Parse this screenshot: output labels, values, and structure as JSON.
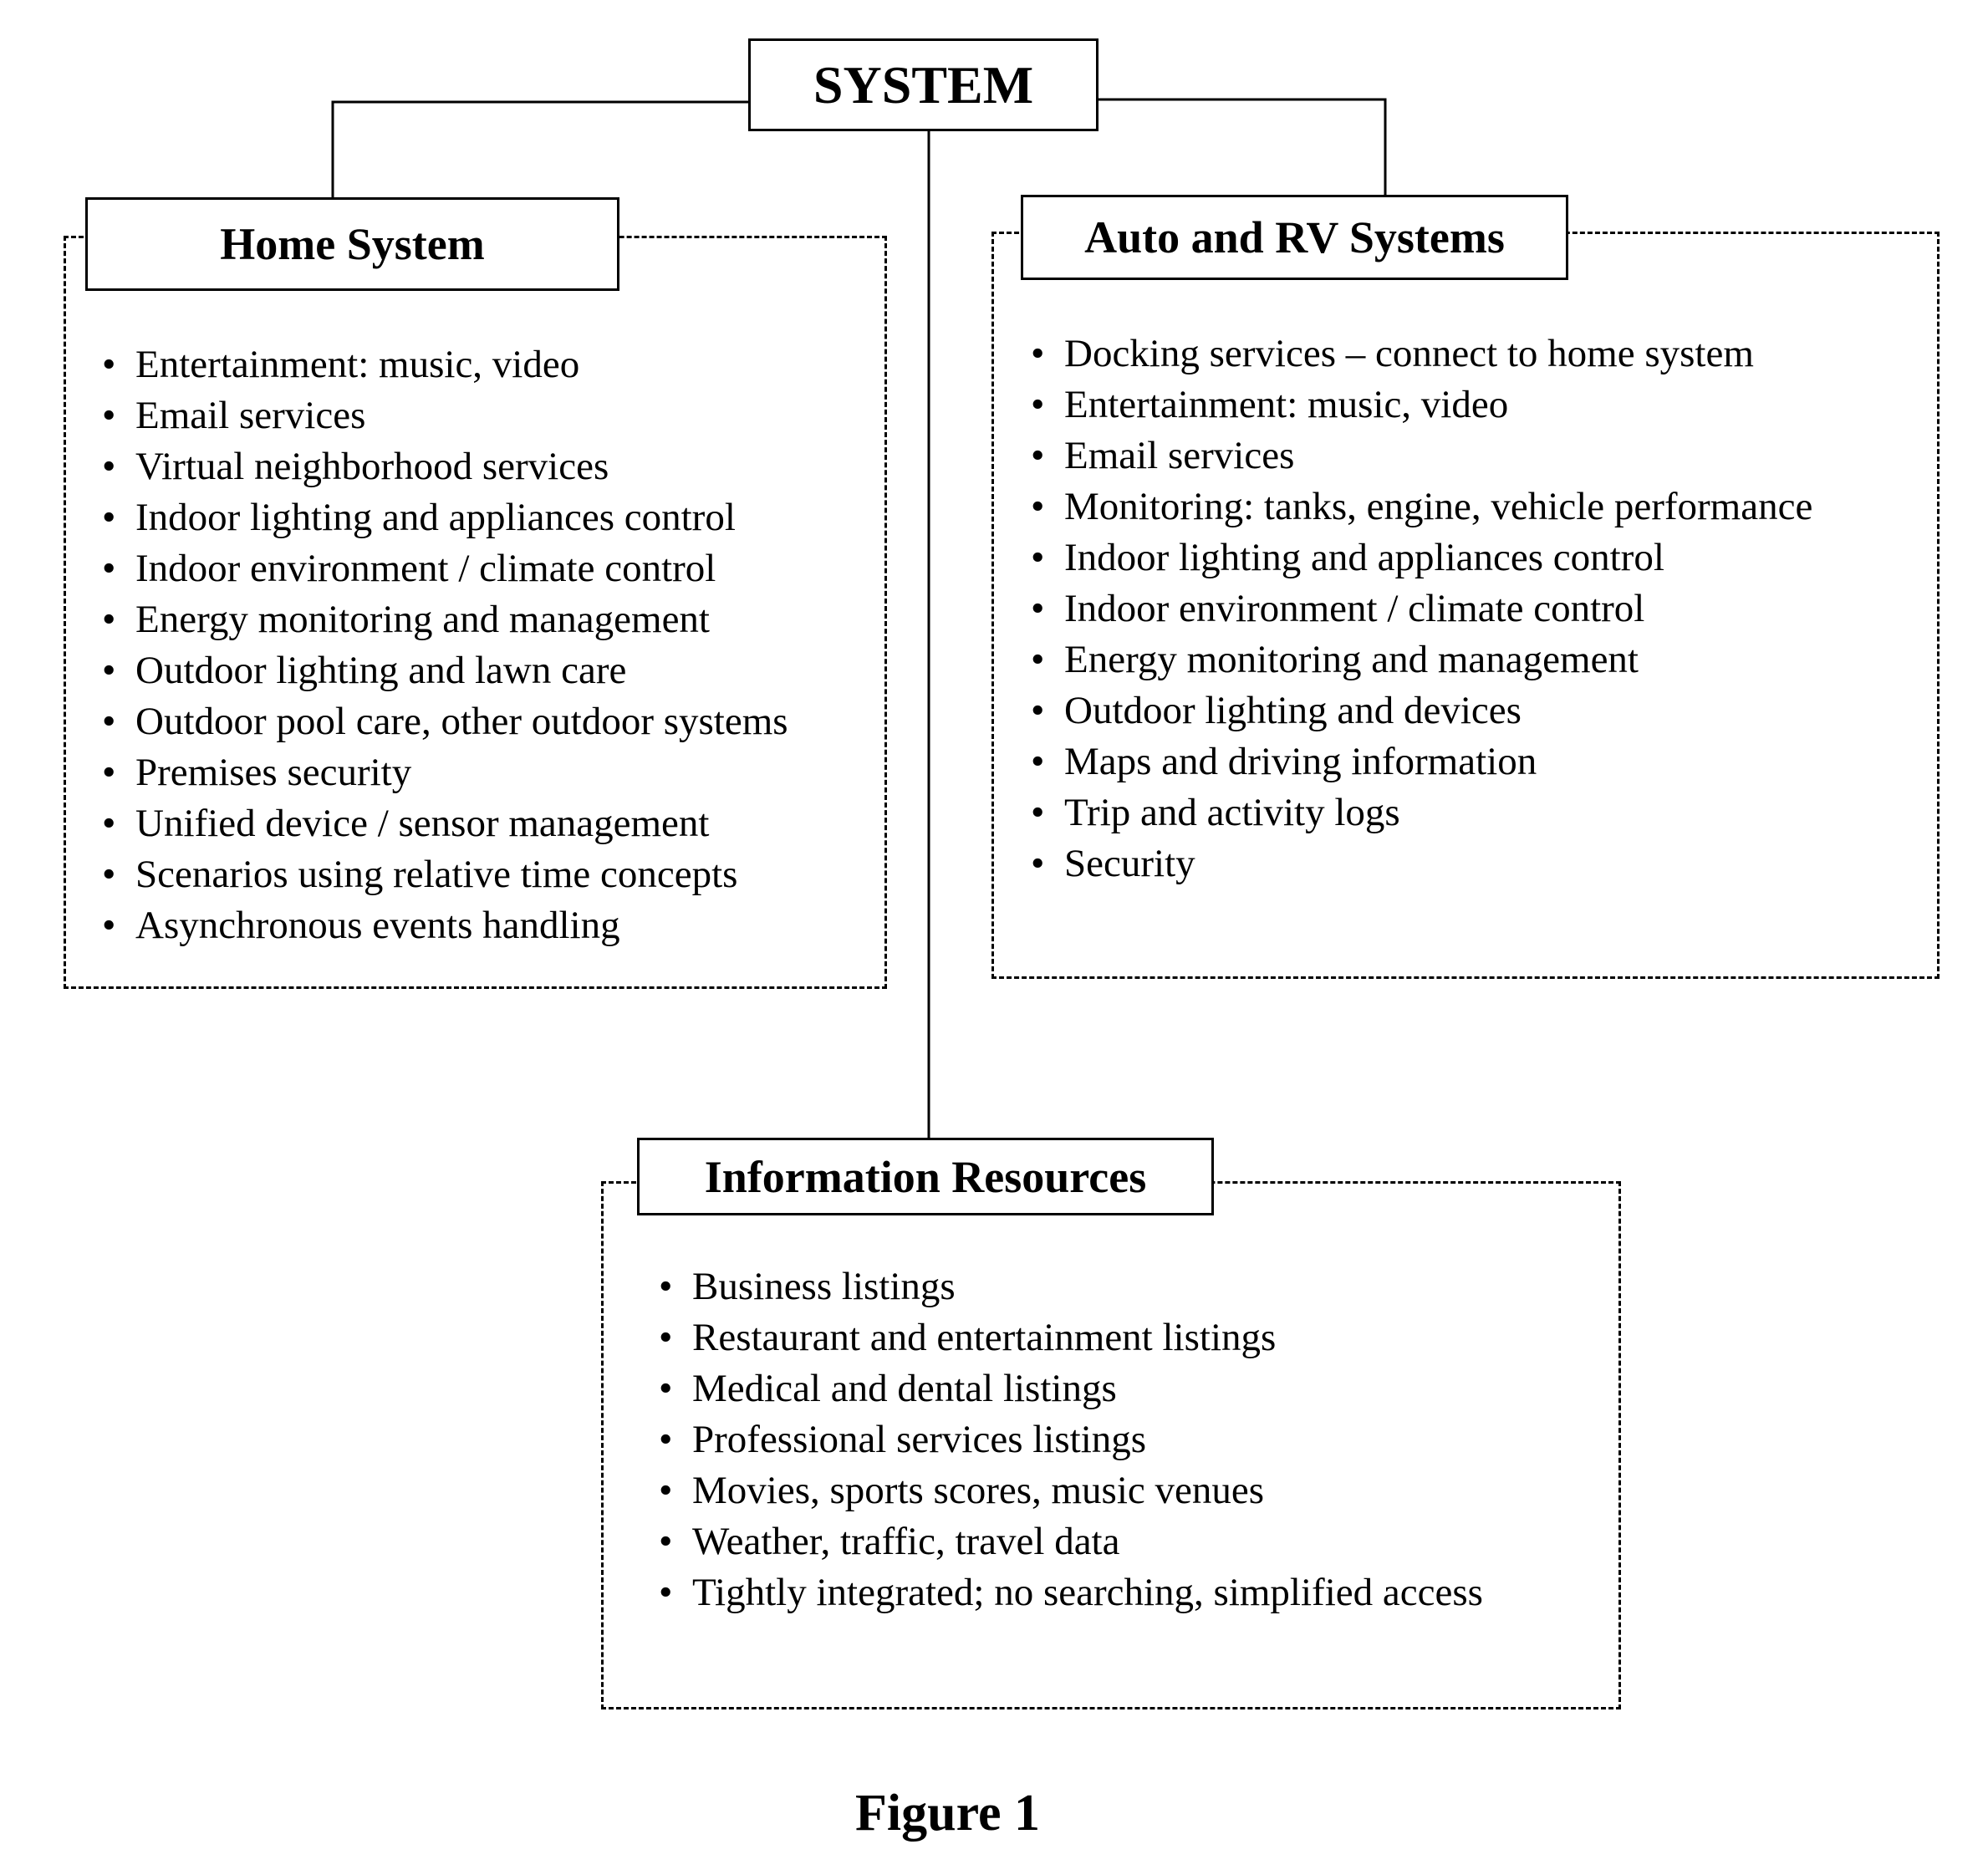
{
  "root": {
    "label": "SYSTEM"
  },
  "home_system": {
    "title": "Home System",
    "items": [
      "Entertainment: music, video",
      "Email services",
      "Virtual neighborhood services",
      "Indoor lighting and appliances control",
      "Indoor environment / climate control",
      "Energy monitoring and management",
      "Outdoor lighting and lawn care",
      "Outdoor pool care, other outdoor systems",
      "Premises security",
      "Unified device / sensor management",
      "Scenarios using relative time concepts",
      "Asynchronous events handling"
    ]
  },
  "auto_rv_systems": {
    "title": "Auto and RV Systems",
    "items": [
      "Docking services – connect to home system",
      "Entertainment: music, video",
      "Email services",
      "Monitoring: tanks, engine, vehicle performance",
      "Indoor lighting and appliances control",
      "Indoor environment / climate control",
      "Energy monitoring and management",
      "Outdoor lighting and devices",
      "Maps and driving information",
      "Trip and activity logs",
      "Security"
    ]
  },
  "information_resources": {
    "title": "Information Resources",
    "items": [
      "Business listings",
      "Restaurant and entertainment listings",
      "Medical and dental listings",
      "Professional services listings",
      "Movies, sports scores, music venues",
      "Weather, traffic, travel data",
      "Tightly integrated; no searching, simplified access"
    ]
  },
  "bullet_glyph": "•",
  "caption": "Figure 1"
}
